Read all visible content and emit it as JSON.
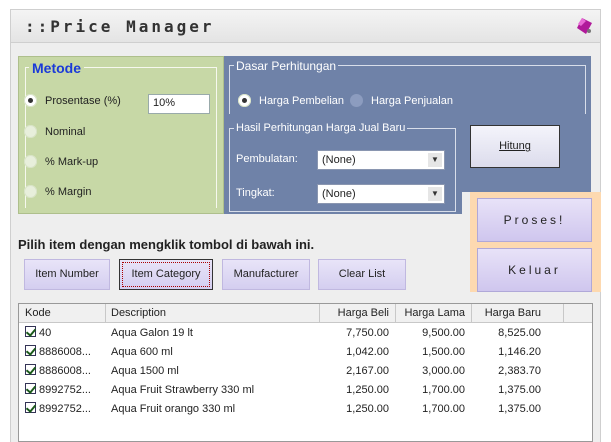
{
  "window": {
    "title": "::Price Manager"
  },
  "metode": {
    "legend": "Metode",
    "options": [
      {
        "label": "Prosentase (%)",
        "selected": true
      },
      {
        "label": "Nominal",
        "selected": false
      },
      {
        "label": "% Mark-up",
        "selected": false
      },
      {
        "label": "% Margin",
        "selected": false
      }
    ],
    "percent_value": "10%"
  },
  "dasar": {
    "legend": "Dasar Perhitungan",
    "options": [
      {
        "label": "Harga Pembelian",
        "selected": true
      },
      {
        "label": "Harga Penjualan",
        "selected": false
      }
    ]
  },
  "hasil": {
    "legend": "Hasil Perhitungan Harga Jual Baru",
    "pembulatan_label": "Pembulatan:",
    "pembulatan_value": "(None)",
    "tingkat_label": "Tingkat:",
    "tingkat_value": "(None)"
  },
  "buttons": {
    "hitung": "Hitung",
    "proses": "Proses!",
    "keluar": "Keluar"
  },
  "instruction": "Pilih item dengan mengklik tombol di bawah ini.",
  "filters": {
    "item_number": "Item Number",
    "item_category": "Item Category",
    "manufacturer": "Manufacturer",
    "clear_list": "Clear List"
  },
  "table": {
    "columns": [
      "Kode",
      "Description",
      "Harga Beli",
      "Harga Lama",
      "Harga Baru"
    ],
    "rows": [
      {
        "kode": "40",
        "desc": "Aqua Galon 19 lt",
        "beli": "7,750.00",
        "lama": "9,500.00",
        "baru": "8,525.00"
      },
      {
        "kode": "8886008...",
        "desc": "Aqua 600 ml",
        "beli": "1,042.00",
        "lama": "1,500.00",
        "baru": "1,146.20"
      },
      {
        "kode": "8886008...",
        "desc": "Aqua 1500 ml",
        "beli": "2,167.00",
        "lama": "3,000.00",
        "baru": "2,383.70"
      },
      {
        "kode": "8992752...",
        "desc": "Aqua Fruit Strawberry 330 ml",
        "beli": "1,250.00",
        "lama": "1,700.00",
        "baru": "1,375.00"
      },
      {
        "kode": "8992752...",
        "desc": "Aqua Fruit orango 330 ml",
        "beli": "1,250.00",
        "lama": "1,700.00",
        "baru": "1,375.00"
      }
    ]
  },
  "colors": {
    "metode_bg": "#c7d8a6",
    "panel_blue": "#6f82a8",
    "accent_orange": "#fdd9b0",
    "legend_blue": "#1a3ad8"
  }
}
